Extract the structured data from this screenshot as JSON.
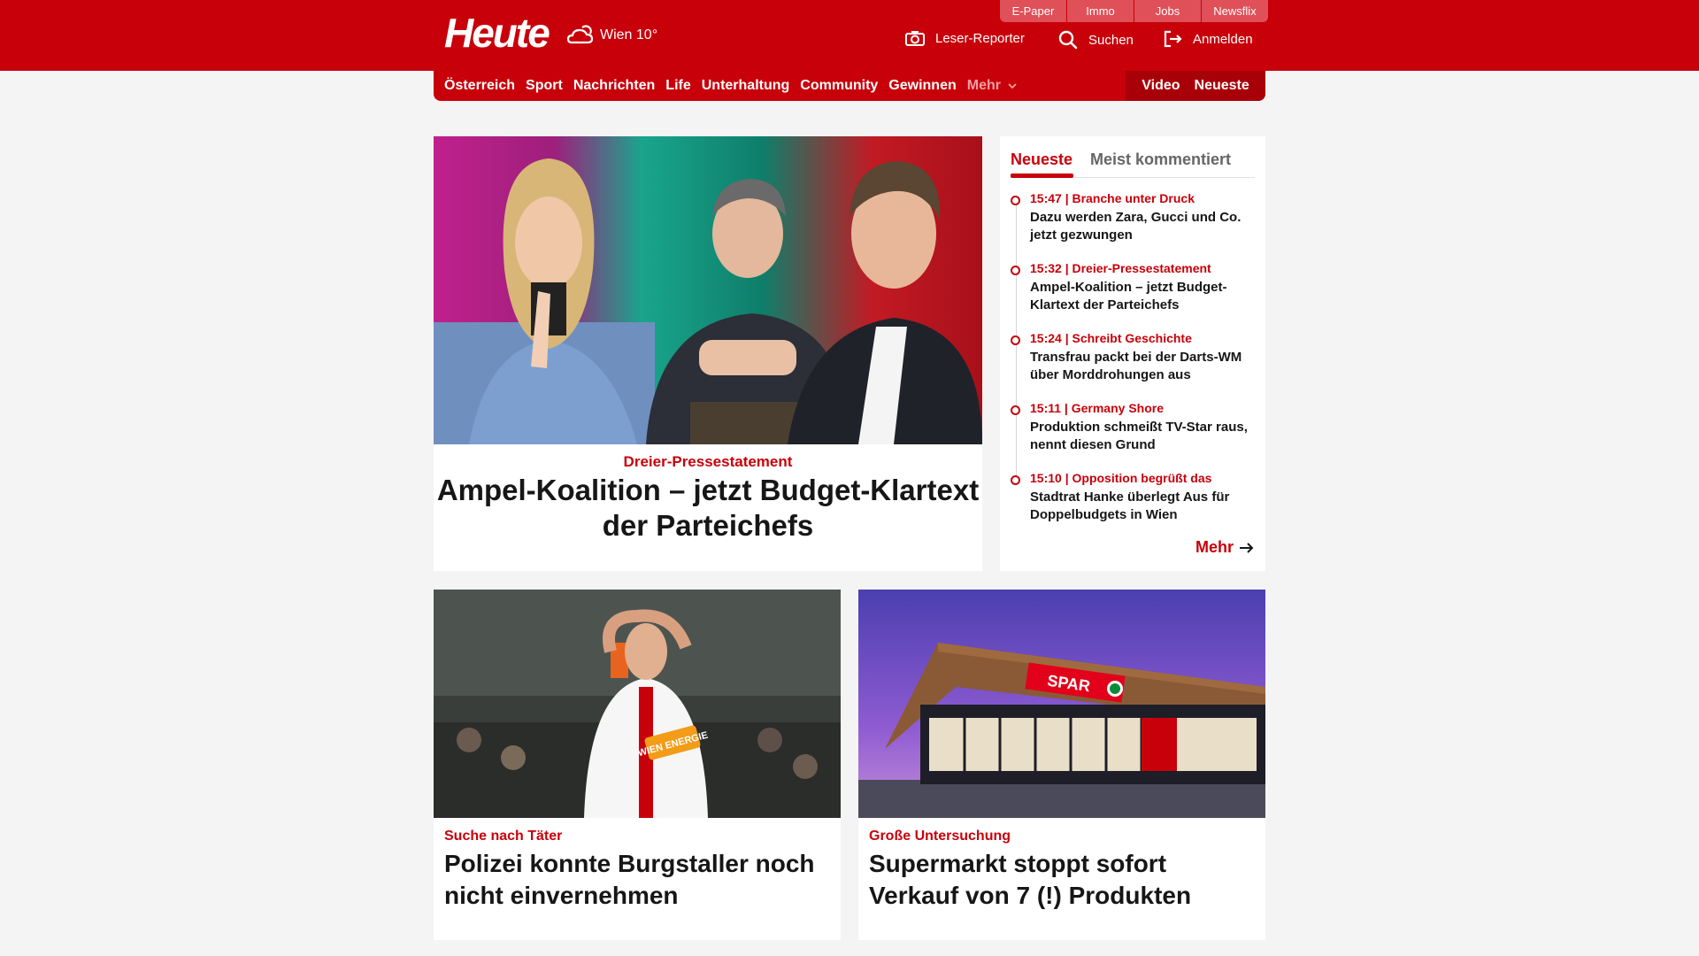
{
  "header": {
    "logo": "Heute",
    "weather": "Wien 10°",
    "topbar": [
      "E-Paper",
      "Immo",
      "Jobs",
      "Newsflix"
    ],
    "leser_reporter": "Leser-Reporter",
    "search": "Suchen",
    "login": "Anmelden"
  },
  "nav": {
    "items": [
      "Österreich",
      "Sport",
      "Nachrichten",
      "Life",
      "Unterhaltung",
      "Community",
      "Gewinnen"
    ],
    "more": "Mehr",
    "video": "Video",
    "latest": "Neueste"
  },
  "hero": {
    "kicker": "Dreier-Pressestatement",
    "title": "Ampel-Koalition – jetzt Budget-Klartext der Parteichefs"
  },
  "sidebar": {
    "tabs": [
      "Neueste",
      "Meist kommentiert"
    ],
    "items": [
      {
        "meta": "15:47 | Branche unter Druck",
        "title": "Dazu werden Zara, Gucci und Co. jetzt gezwungen"
      },
      {
        "meta": "15:32 | Dreier-Pressestatement",
        "title": "Ampel-Koalition – jetzt Budget-Klartext der Parteichefs"
      },
      {
        "meta": "15:24 | Schreibt Geschichte",
        "title": "Transfrau packt bei der Darts-WM über Morddrohungen aus"
      },
      {
        "meta": "15:11 | Germany Shore",
        "title": "Produktion schmeißt TV-Star raus, nennt diesen Grund"
      },
      {
        "meta": "15:10 | Opposition begrüßt das",
        "title": "Stadtrat Hanke überlegt Aus für Doppelbudgets in Wien"
      }
    ],
    "more": "Mehr"
  },
  "cards": [
    {
      "kicker": "Suche nach Täter",
      "title": "Polizei konnte Burgstaller noch nicht einvernehmen",
      "jersey_text": "WIEN ENERGIE"
    },
    {
      "kicker": "Große Untersuchung",
      "title": "Supermarkt stoppt sofort Verkauf von 7 (!) Produkten",
      "store_sign": "SPAR"
    }
  ],
  "colors": {
    "brand": "#c8000a"
  }
}
